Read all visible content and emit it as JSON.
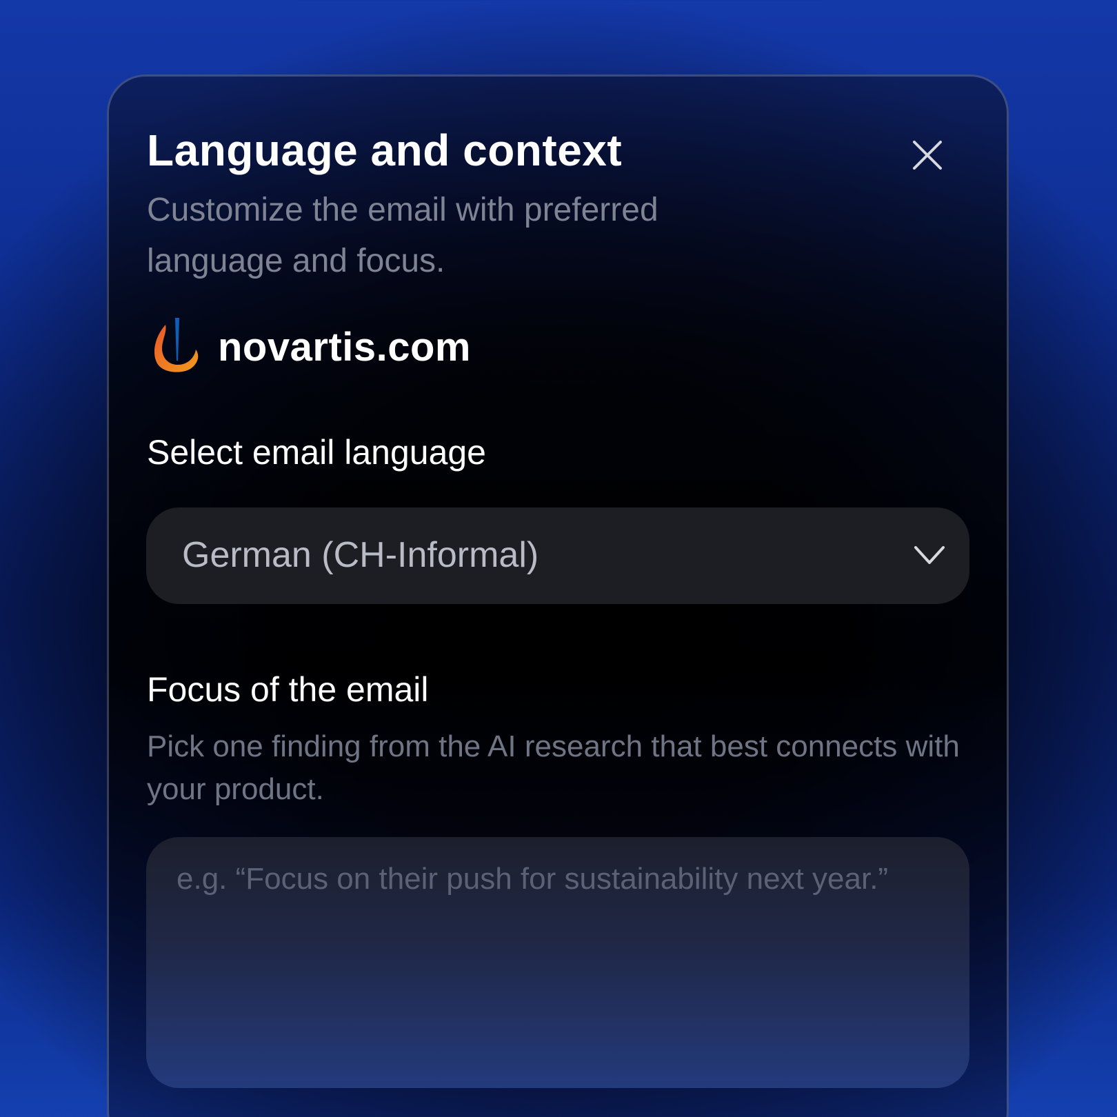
{
  "dialog": {
    "title": "Language and context",
    "subtitle": "Customize the email with preferred language and focus."
  },
  "company": {
    "domain": "novartis.com",
    "logo_icon": "novartis-flame-logo",
    "logo_colors": [
      "#e8572a",
      "#f39b1d",
      "#0e5fb8"
    ]
  },
  "language_field": {
    "label": "Select email language",
    "selected": "German (CH-Informal)",
    "icon": "chevron-down-icon"
  },
  "focus_field": {
    "label": "Focus of the email",
    "description": "Pick one finding from the AI research that best connects with your product.",
    "placeholder": "e.g. “Focus on their push for sustainability next year.”"
  },
  "close_icon": "close-icon"
}
